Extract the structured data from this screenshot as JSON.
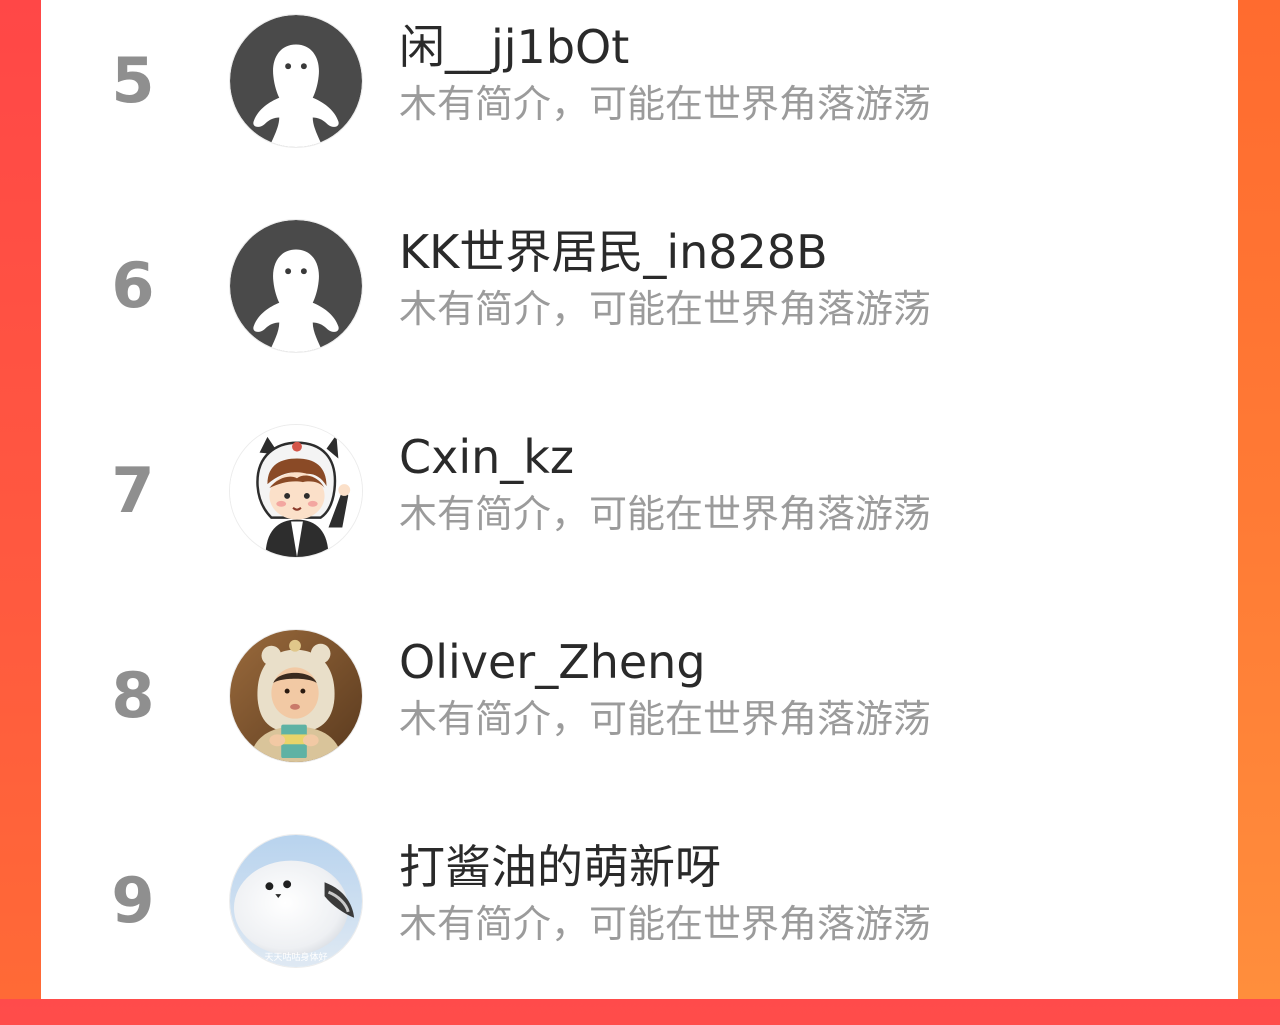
{
  "users": [
    {
      "rank": "5",
      "name": "闲__jj1bOt",
      "bio": "木有简介，可能在世界角落游荡",
      "avatar": "default-ghost-avatar"
    },
    {
      "rank": "6",
      "name": "KK世界居民_in828B",
      "bio": "木有简介，可能在世界角落游荡",
      "avatar": "default-ghost-avatar"
    },
    {
      "rank": "7",
      "name": "Cxin_kz",
      "bio": "木有简介，可能在世界角落游荡",
      "avatar": "cartoon-child-avatar"
    },
    {
      "rank": "8",
      "name": "Oliver_Zheng",
      "bio": "木有简介，可能在世界角落游荡",
      "avatar": "baby-photo-avatar"
    },
    {
      "rank": "9",
      "name": "打酱油的萌新呀",
      "bio": "木有简介，可能在世界角落游荡",
      "avatar": "white-bird-avatar",
      "avatar_caption": "天天咕咕身体好"
    }
  ],
  "colors": {
    "background_left": "#ff4b4b",
    "background_right": "#ff8a35",
    "panel": "#ffffff",
    "rank_text": "#8f8f8f",
    "name_text": "#2a2a2a",
    "bio_text": "#9b9b9b"
  }
}
